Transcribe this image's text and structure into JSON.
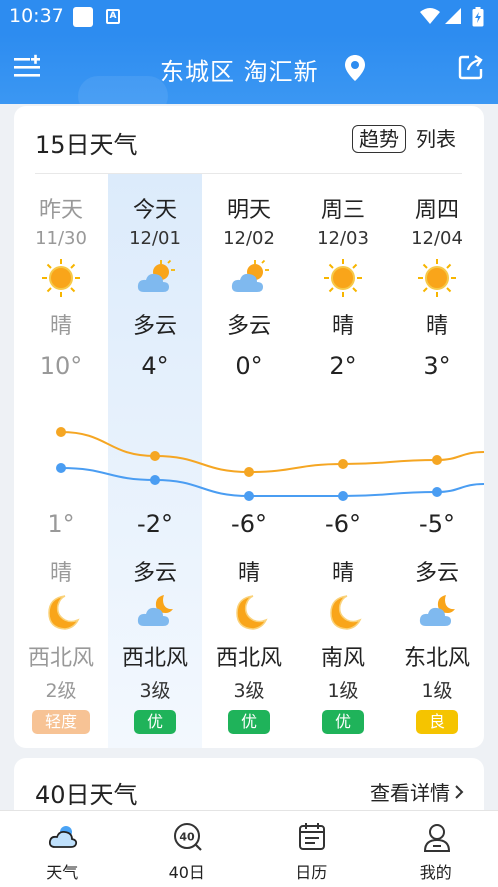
{
  "status_bar": {
    "time": "10:37",
    "a_icon": "A"
  },
  "header": {
    "location": "东城区 淘汇新"
  },
  "forecast": {
    "title": "15日天气",
    "tab_trend": "趋势",
    "tab_list": "列表",
    "days": [
      {
        "day": "昨天",
        "date": "11/30",
        "cond_day": "晴",
        "high": "10°",
        "low": "1°",
        "cond_night": "晴",
        "wind": "西北风",
        "level": "2级",
        "aqi": "轻度",
        "aqi_color": "#f7c395",
        "icon_day": "sun-icon",
        "icon_night": "moon-icon",
        "past": true
      },
      {
        "day": "今天",
        "date": "12/01",
        "cond_day": "多云",
        "high": "4°",
        "low": "-2°",
        "cond_night": "多云",
        "wind": "西北风",
        "level": "3级",
        "aqi": "优",
        "aqi_color": "#1fb35a",
        "icon_day": "partly-cloudy-icon",
        "icon_night": "cloudy-night-icon",
        "past": false
      },
      {
        "day": "明天",
        "date": "12/02",
        "cond_day": "多云",
        "high": "0°",
        "low": "-6°",
        "cond_night": "晴",
        "wind": "西北风",
        "level": "3级",
        "aqi": "优",
        "aqi_color": "#1fb35a",
        "icon_day": "partly-cloudy-icon",
        "icon_night": "moon-icon",
        "past": false
      },
      {
        "day": "周三",
        "date": "12/03",
        "cond_day": "晴",
        "high": "2°",
        "low": "-6°",
        "cond_night": "晴",
        "wind": "南风",
        "level": "1级",
        "aqi": "优",
        "aqi_color": "#1fb35a",
        "icon_day": "sun-icon",
        "icon_night": "moon-icon",
        "past": false
      },
      {
        "day": "周四",
        "date": "12/04",
        "cond_day": "晴",
        "high": "3°",
        "low": "-5°",
        "cond_night": "多云",
        "wind": "东北风",
        "level": "1级",
        "aqi": "良",
        "aqi_color": "#f5c400",
        "icon_day": "sun-icon",
        "icon_night": "cloudy-night-icon",
        "past": false
      }
    ]
  },
  "chart_data": {
    "type": "line",
    "categories": [
      "11/30",
      "12/01",
      "12/02",
      "12/03",
      "12/04"
    ],
    "series": [
      {
        "values": [
          10,
          4,
          0,
          2,
          3
        ],
        "color": "#f5a623"
      },
      {
        "values": [
          1,
          -2,
          -6,
          -6,
          -5
        ],
        "color": "#4a9df2"
      }
    ]
  },
  "forty_day": {
    "title": "40日天气",
    "more": "查看详情"
  },
  "nav": {
    "items": [
      {
        "label": "天气",
        "icon": "weather-icon"
      },
      {
        "label": "40日",
        "icon": "forty-day-icon"
      },
      {
        "label": "日历",
        "icon": "calendar-icon"
      },
      {
        "label": "我的",
        "icon": "profile-icon"
      }
    ]
  },
  "colors": {
    "brand": "#2d8cf0",
    "high_line": "#f5a623",
    "low_line": "#4a9df2"
  }
}
